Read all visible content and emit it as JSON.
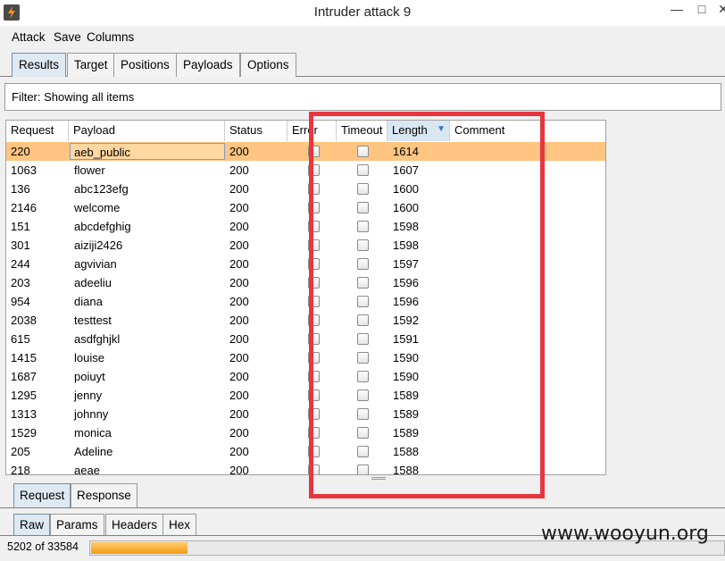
{
  "window": {
    "title": "Intruder attack 9",
    "controls": [
      "—",
      "□",
      "✕"
    ]
  },
  "menu": [
    "Attack",
    "Save",
    "Columns"
  ],
  "tabs": [
    "Results",
    "Target",
    "Positions",
    "Payloads",
    "Options"
  ],
  "active_tab": "Results",
  "filter": {
    "text": "Filter: Showing all items"
  },
  "table": {
    "columns": [
      "Request",
      "Payload",
      "Status",
      "Error",
      "Timeout",
      "Length",
      "Comment"
    ],
    "sorted_column": "Length",
    "sort_indicator": "▼",
    "rows": [
      {
        "request": "220",
        "payload": "aeb_public",
        "status": "200",
        "length": "1614"
      },
      {
        "request": "1063",
        "payload": "flower",
        "status": "200",
        "length": "1607"
      },
      {
        "request": "136",
        "payload": "abc123efg",
        "status": "200",
        "length": "1600"
      },
      {
        "request": "2146",
        "payload": "welcome",
        "status": "200",
        "length": "1600"
      },
      {
        "request": "151",
        "payload": "abcdefghig",
        "status": "200",
        "length": "1598"
      },
      {
        "request": "301",
        "payload": "aiziji2426",
        "status": "200",
        "length": "1598"
      },
      {
        "request": "244",
        "payload": "agvivian",
        "status": "200",
        "length": "1597"
      },
      {
        "request": "203",
        "payload": "adeeliu",
        "status": "200",
        "length": "1596"
      },
      {
        "request": "954",
        "payload": "diana",
        "status": "200",
        "length": "1596"
      },
      {
        "request": "2038",
        "payload": "testtest",
        "status": "200",
        "length": "1592"
      },
      {
        "request": "615",
        "payload": "asdfghjkl",
        "status": "200",
        "length": "1591"
      },
      {
        "request": "1415",
        "payload": "louise",
        "status": "200",
        "length": "1590"
      },
      {
        "request": "1687",
        "payload": "poiuyt",
        "status": "200",
        "length": "1590"
      },
      {
        "request": "1295",
        "payload": "jenny",
        "status": "200",
        "length": "1589"
      },
      {
        "request": "1313",
        "payload": "johnny",
        "status": "200",
        "length": "1589"
      },
      {
        "request": "1529",
        "payload": "monica",
        "status": "200",
        "length": "1589"
      },
      {
        "request": "205",
        "payload": "Adeline",
        "status": "200",
        "length": "1588"
      },
      {
        "request": "218",
        "payload": "aeae",
        "status": "200",
        "length": "1588"
      }
    ]
  },
  "detail_tabs": [
    "Request",
    "Response"
  ],
  "view_tabs": [
    "Raw",
    "Params",
    "Headers",
    "Hex"
  ],
  "status": {
    "text": "5202 of 33584",
    "done": 5202,
    "total": 33584
  },
  "watermark": "www.wooyun.org",
  "colors": {
    "selected_row": "#ffc580",
    "highlight_box": "#e8363f",
    "progress": "#f49a1a"
  }
}
